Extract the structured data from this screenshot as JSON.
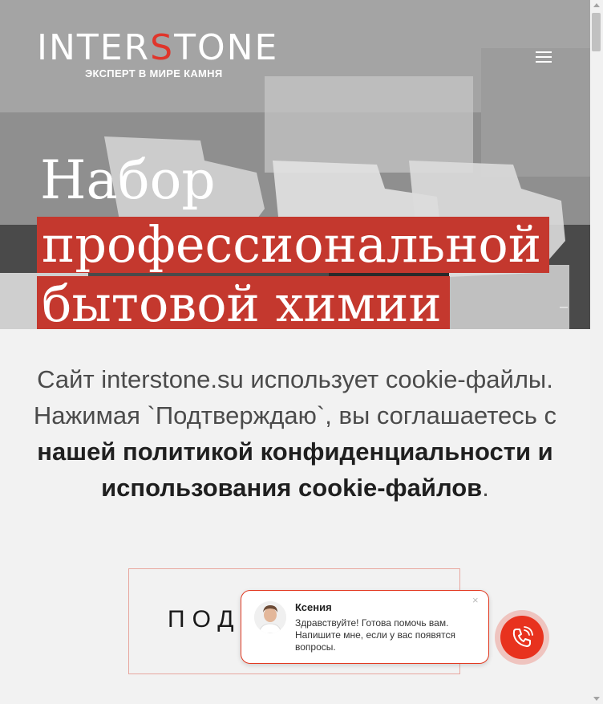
{
  "header": {
    "logo_inter": "INTER",
    "logo_s": "S",
    "logo_tone": "TONE",
    "tagline": "ЭКСПЕРТ В МИРЕ КАМНЯ",
    "menu_icon": "hamburger-icon"
  },
  "hero": {
    "title_line1": "Набор",
    "title_line2": "профессиональной",
    "title_line3": "бытовой химии",
    "accent_color": "#c4382e"
  },
  "cookie": {
    "text_plain": "Сайт interstone.su использует cookie-файлы. Нажимая `Подтверждаю`, вы соглашаетесь с ",
    "text_bold": "нашей политикой конфиденциальности и использования cookie-файлов",
    "text_end": ".",
    "button_label": "ПОДТ"
  },
  "chat": {
    "name": "Ксения",
    "message": "Здравствуйте! Готова помочь вам. Напишите мне, если у вас появятся вопросы.",
    "close_label": "×",
    "call_icon": "phone-icon"
  },
  "colors": {
    "brand_red": "#e0352b",
    "chat_red": "#e8321e"
  }
}
